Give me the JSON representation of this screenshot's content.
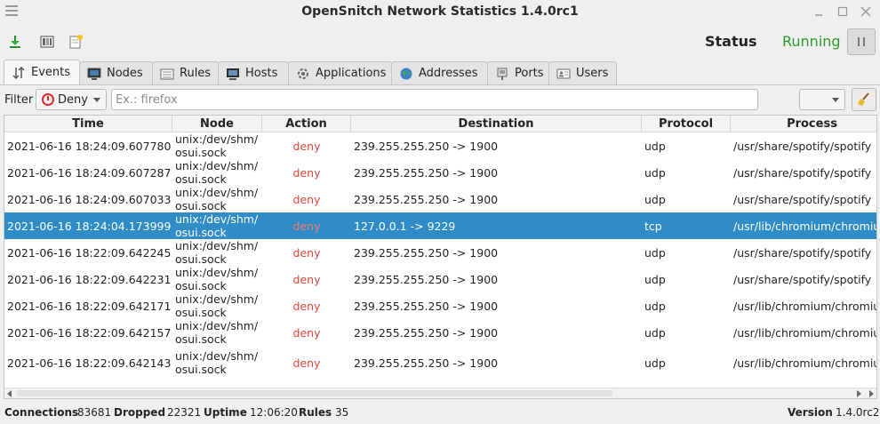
{
  "window": {
    "title": "OpenSnitch Network Statistics 1.4.0rc1",
    "controls": [
      "minimize-icon",
      "maximize-icon",
      "close-icon"
    ]
  },
  "toolbar": {
    "buttons": [
      "save-icon",
      "columns-icon",
      "new-rule-icon"
    ],
    "status_label": "Status",
    "status_value": "Running",
    "status_color": "#2e9a2e"
  },
  "tabs": [
    {
      "label": "Events",
      "icon": "events-icon",
      "active": true
    },
    {
      "label": "Nodes",
      "icon": "nodes-icon",
      "active": false
    },
    {
      "label": "Rules",
      "icon": "rules-icon",
      "active": false
    },
    {
      "label": "Hosts",
      "icon": "hosts-icon",
      "active": false
    },
    {
      "label": "Applications",
      "icon": "applications-icon",
      "active": false
    },
    {
      "label": "Addresses",
      "icon": "addresses-icon",
      "active": false
    },
    {
      "label": "Ports",
      "icon": "ports-icon",
      "active": false
    },
    {
      "label": "Users",
      "icon": "users-icon",
      "active": false
    }
  ],
  "filter": {
    "label": "Filter",
    "action_value": "Deny",
    "search_placeholder": "Ex.: firefox",
    "limit_value": ""
  },
  "table": {
    "columns": [
      "Time",
      "Node",
      "Action",
      "Destination",
      "Protocol",
      "Process"
    ],
    "rows": [
      {
        "time": "2021-06-16 18:24:09.607780",
        "node": "unix:/dev/shm/\nosui.sock",
        "action": "deny",
        "destination": "239.255.255.250  ->  1900",
        "protocol": "udp",
        "process": "/usr/share/spotify/spotify"
      },
      {
        "time": "2021-06-16 18:24:09.607287",
        "node": "unix:/dev/shm/\nosui.sock",
        "action": "deny",
        "destination": "239.255.255.250  ->  1900",
        "protocol": "udp",
        "process": "/usr/share/spotify/spotify"
      },
      {
        "time": "2021-06-16 18:24:09.607033",
        "node": "unix:/dev/shm/\nosui.sock",
        "action": "deny",
        "destination": "239.255.255.250  ->  1900",
        "protocol": "udp",
        "process": "/usr/share/spotify/spotify"
      },
      {
        "time": "2021-06-16 18:24:04.173999",
        "node": "unix:/dev/shm/\nosui.sock",
        "action": "deny",
        "destination": "127.0.0.1  ->  9229",
        "protocol": "tcp",
        "process": "/usr/lib/chromium/chromium",
        "selected": true
      },
      {
        "time": "2021-06-16 18:22:09.642245",
        "node": "unix:/dev/shm/\nosui.sock",
        "action": "deny",
        "destination": "239.255.255.250  ->  1900",
        "protocol": "udp",
        "process": "/usr/share/spotify/spotify"
      },
      {
        "time": "2021-06-16 18:22:09.642231",
        "node": "unix:/dev/shm/\nosui.sock",
        "action": "deny",
        "destination": "239.255.255.250  ->  1900",
        "protocol": "udp",
        "process": "/usr/share/spotify/spotify"
      },
      {
        "time": "2021-06-16 18:22:09.642171",
        "node": "unix:/dev/shm/\nosui.sock",
        "action": "deny",
        "destination": "239.255.255.250  ->  1900",
        "protocol": "udp",
        "process": "/usr/lib/chromium/chromium"
      },
      {
        "time": "2021-06-16 18:22:09.642157",
        "node": "unix:/dev/shm/\nosui.sock",
        "action": "deny",
        "destination": "239.255.255.250  ->  1900",
        "protocol": "udp",
        "process": "/usr/lib/chromium/chromium"
      },
      {
        "time": "2021-06-16 18:22:09.642143",
        "node": "unix:/dev/shm/\nosui.sock",
        "action": "deny",
        "destination": "239.255.255.250  ->  1900",
        "protocol": "udp",
        "process": "/usr/lib/chromium/chromium",
        "tall": true
      }
    ]
  },
  "statusbar": {
    "connections_label": "Connections",
    "connections_value": "83681",
    "dropped_label": "Dropped",
    "dropped_value": "22321",
    "uptime_label": "Uptime",
    "uptime_value": "12:06:20",
    "rules_label": "Rules",
    "rules_value": "35",
    "version_label": "Version",
    "version_value": "1.4.0rc2"
  },
  "colors": {
    "accent_selection": "#308cc6",
    "deny_text": "#e0473a",
    "running_green": "#2e9a2e"
  }
}
